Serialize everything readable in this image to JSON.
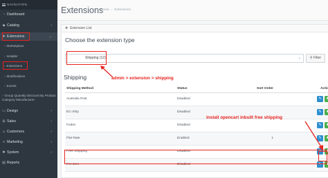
{
  "sidebar": {
    "header": "NAVIGATION",
    "items": [
      {
        "label": "Dashboard",
        "icon": "dashboard-icon"
      },
      {
        "label": "Catalog",
        "icon": "tag-icon"
      },
      {
        "label": "Extensions",
        "icon": "puzzle-icon"
      }
    ],
    "sub_items": [
      "Marketplace",
      "Installer",
      "Extensions",
      "Modifications",
      "Events",
      "Group Quantity Discount By Product Category Manufacturer"
    ],
    "bottom_items": [
      {
        "label": "Design",
        "icon": "desktop-icon"
      },
      {
        "label": "Sales",
        "icon": "cart-icon"
      },
      {
        "label": "Customers",
        "icon": "user-icon"
      },
      {
        "label": "Marketing",
        "icon": "share-icon"
      },
      {
        "label": "System",
        "icon": "cog-icon"
      },
      {
        "label": "Reports",
        "icon": "chart-icon"
      }
    ]
  },
  "header": {
    "title": "Extensions",
    "breadcrumb": [
      "Home",
      "Extensions"
    ]
  },
  "panel": {
    "heading": "Extension List",
    "choose_title": "Choose the extension type",
    "select_value": "Shipping (12)",
    "filter_label": "Filter",
    "section_title": "Shipping"
  },
  "annotations": {
    "path": "admin > extension > shipping",
    "install": "install opencart inbuilt free shipping"
  },
  "table": {
    "headers": [
      "Shipping Method",
      "Status",
      "Sort Order",
      "Action"
    ],
    "rows": [
      {
        "method": "Australia Post",
        "status": "Disabled",
        "sort": ""
      },
      {
        "method": "EC-Ship",
        "status": "Disabled",
        "sort": ""
      },
      {
        "method": "Fedex",
        "status": "Disabled",
        "sort": ""
      },
      {
        "method": "Flat Rate",
        "status": "Enabled",
        "sort": "1"
      },
      {
        "method": "Free Shipping",
        "status": "Disabled",
        "sort": ""
      },
      {
        "method": "Per Item",
        "status": "Disabled",
        "sort": ""
      }
    ]
  },
  "colors": {
    "accent_red": "#e8231f",
    "edit_blue": "#2e8fd0",
    "install_green": "#4cae4c",
    "sidebar_bg": "#2e3740"
  }
}
